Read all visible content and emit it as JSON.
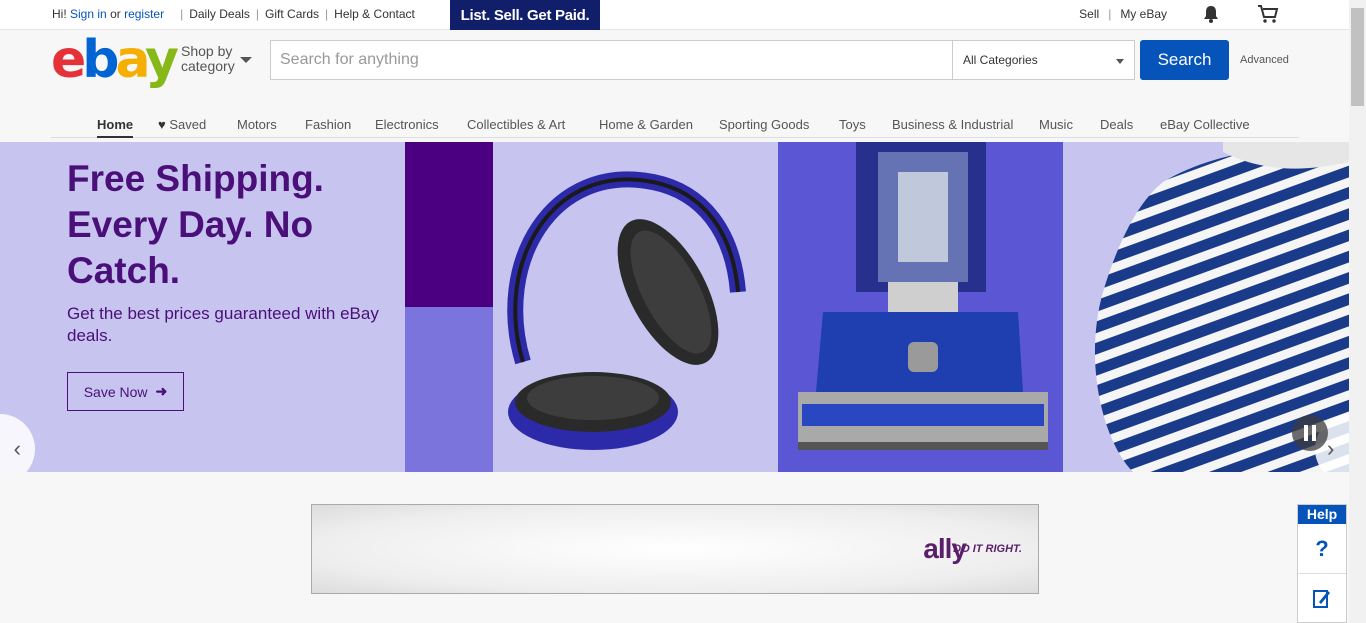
{
  "topbar": {
    "greeting": "Hi!",
    "sign_in": "Sign in",
    "or": "or",
    "register": "register",
    "links": [
      "Daily Deals",
      "Gift Cards",
      "Help & Contact"
    ],
    "promo": "List. Sell. Get Paid.",
    "sell": "Sell",
    "my_ebay": "My eBay",
    "notification_icon": "bell-icon",
    "cart_icon": "cart-icon"
  },
  "header": {
    "logo": [
      "e",
      "b",
      "a",
      "y"
    ],
    "logo_colors": [
      "#e53238",
      "#0064d2",
      "#f5af02",
      "#86b817"
    ],
    "shop_by_line1": "Shop by",
    "shop_by_line2": "category",
    "search_placeholder": "Search for anything",
    "category_selected": "All Categories",
    "search_button": "Search",
    "advanced": "Advanced"
  },
  "nav": {
    "items": [
      "Home",
      "Saved",
      "Motors",
      "Fashion",
      "Electronics",
      "Collectibles & Art",
      "Home & Garden",
      "Sporting Goods",
      "Toys",
      "Business & Industrial",
      "Music",
      "Deals",
      "eBay Collective"
    ]
  },
  "hero": {
    "headline": "Free Shipping. Every Day. No Catch.",
    "subtext": "Get the best prices guaranteed with eBay deals.",
    "cta": "Save Now",
    "cta_icon": "arrow-right-icon",
    "images": [
      "headphones",
      "vacuum-cleaner",
      "striped-shirt"
    ],
    "accent_color": "#4a0f78"
  },
  "ad": {
    "brand": "ally",
    "tagline": "DO IT RIGHT."
  },
  "help_widget": {
    "title": "Help",
    "question": "?"
  }
}
